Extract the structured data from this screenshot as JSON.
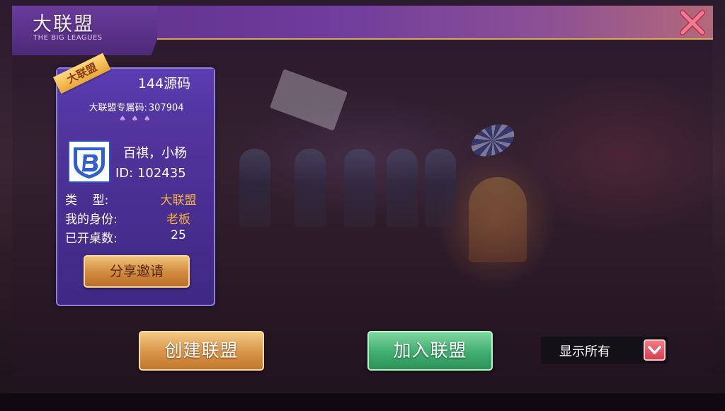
{
  "header": {
    "title": "大联盟",
    "subtitle": "THE BIG LEAGUES",
    "close_icon": "close-icon"
  },
  "league_card": {
    "ribbon": "大联盟",
    "name": "144源码",
    "code_label": "大联盟专属码:",
    "code_value": "307904",
    "owner_name": "百祺，小杨",
    "owner_id": "ID: 102435",
    "rows": [
      {
        "label": "类    型:",
        "value": "大联盟"
      },
      {
        "label": "我的身份:",
        "value": "老板"
      },
      {
        "label": "已开桌数:",
        "value": "25"
      }
    ],
    "share_label": "分享邀请"
  },
  "actions": {
    "create_label": "创建联盟",
    "join_label": "加入联盟"
  },
  "filter": {
    "selected": "显示所有",
    "arrow_icon": "chevron-down-icon"
  },
  "colors": {
    "header_purple": "#6f3c9d",
    "card_purple": "#4a2f92",
    "gold": "#f2b13c",
    "green": "#3fae6e",
    "close_pink": "#e8607a"
  }
}
